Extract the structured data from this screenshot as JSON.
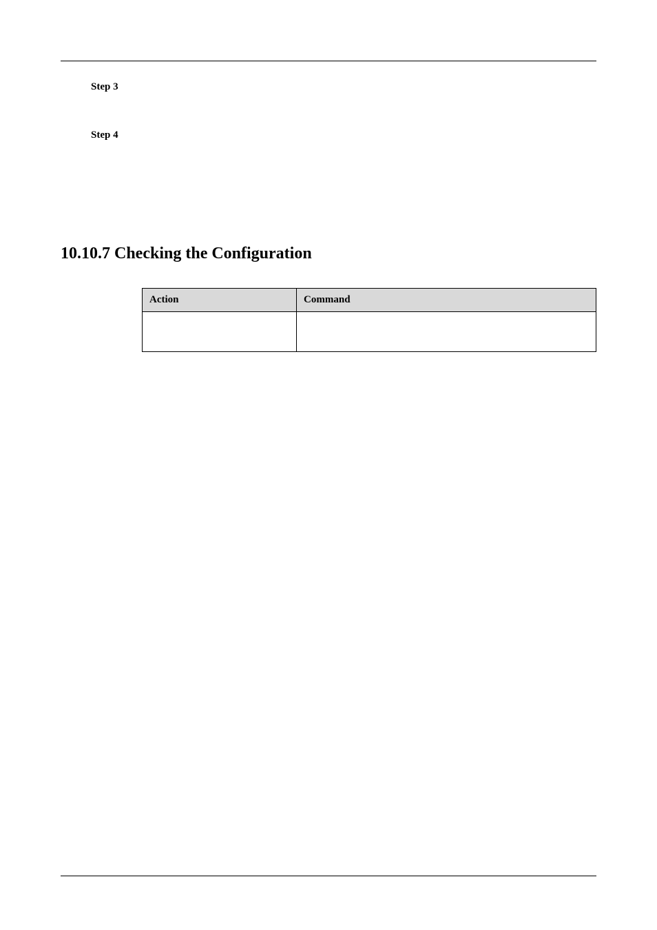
{
  "steps": [
    {
      "label": "Step 3"
    },
    {
      "label": "Step 4"
    }
  ],
  "section_heading": "10.10.7 Checking the Configuration",
  "table": {
    "headers": {
      "action": "Action",
      "command": "Command"
    },
    "rows": [
      {
        "action": "",
        "command": ""
      }
    ]
  }
}
